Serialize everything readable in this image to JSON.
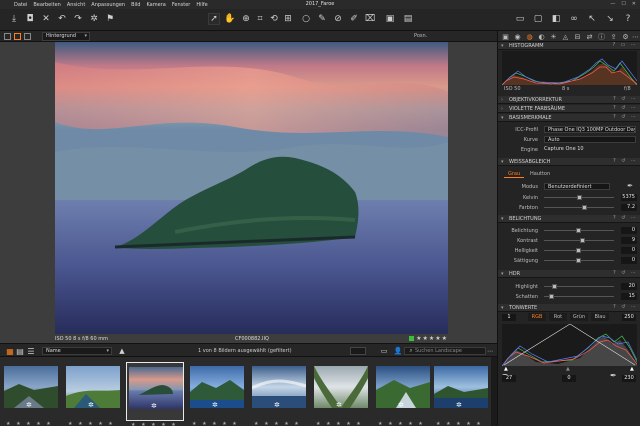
{
  "menu": {
    "items": [
      "Datei",
      "Bearbeiten",
      "Ansicht",
      "Anpassungen",
      "Bild",
      "Kamera",
      "Fenster",
      "Hilfe"
    ],
    "window_title": "2017_Faroe"
  },
  "viewer_header": {
    "layer_select": "Hintergrund",
    "position_label": "Posn."
  },
  "photo_info": {
    "exif": "ISO 50  8 s  f/8  60 mm",
    "filename": "CF000882.IIQ",
    "stars": "★★★★★"
  },
  "browser": {
    "sort_select": "Name",
    "count_text": "1 von 8 Bildern ausgewählt (gefiltert)",
    "search_placeholder": "Suchen Landscape",
    "thumb_stars": "★ ★ ★ ★ ★"
  },
  "histogram": {
    "title": "HISTOGRAMM",
    "labels": [
      "ISO 50",
      "8 s",
      "f/8"
    ]
  },
  "sections": {
    "objektiv": "OBJEKTIVKORREKTUR",
    "violette": "VIOLETTE FARBSÄUME",
    "basis": "BASISMERKMALE",
    "weiss": "WEISSABGLEICH",
    "belichtung": "BELICHTUNG",
    "hdr": "HDR",
    "tonwerte": "TONWERTE"
  },
  "basis": {
    "icc_label": "ICC-Profil",
    "icc_value": "Phase One IQ3 100MP Outdoor Dayl",
    "kurve_label": "Kurve",
    "kurve_value": "Auto",
    "engine_label": "Engine",
    "engine_value": "Capture One 10"
  },
  "wb": {
    "tab_grau": "Grau",
    "tab_hautton": "Hautton",
    "modus_label": "Modus",
    "modus_value": "Benutzerdefiniert",
    "kelvin_label": "Kelvin",
    "kelvin_value": "5375",
    "farbton_label": "Farbton",
    "farbton_value": "7.2"
  },
  "exposure": {
    "belichtung_label": "Belichtung",
    "belichtung_value": "0",
    "kontrast_label": "Kontrast",
    "kontrast_value": "9",
    "helligkeit_label": "Helligkeit",
    "helligkeit_value": "0",
    "saettigung_label": "Sättigung",
    "saettigung_value": "0"
  },
  "hdr": {
    "highlight_label": "Highlight",
    "highlight_value": "20",
    "schatten_label": "Schatten",
    "schatten_value": "15"
  },
  "levels": {
    "tabs": [
      "RGB",
      "Rot",
      "Grün",
      "Blau"
    ],
    "in_low": "1",
    "in_high": "250",
    "out_low": "27",
    "out_mid": "0",
    "out_high": "230"
  },
  "colors": {
    "accent": "#ff7f1f",
    "panel_bg": "#242424",
    "viewer_bg": "#3d3d3d",
    "rating_green": "#3cbf3c"
  },
  "icons": {
    "toolbar": [
      "import-icon",
      "camera-icon",
      "delete-icon",
      "undo-icon",
      "redo-icon",
      "settings-icon",
      "flag-icon",
      "cursor-icon",
      "hand-icon",
      "zoom-icon",
      "crop-icon",
      "rotate-icon",
      "keystone-icon",
      "circle-mask-icon",
      "brush-icon",
      "picker-icon",
      "annotate-icon",
      "text-icon",
      "exposure-warning-icon",
      "proof-icon",
      "compare-icon",
      "copy-adjustments-icon",
      "apply-adjustments-icon",
      "help-icon"
    ]
  }
}
